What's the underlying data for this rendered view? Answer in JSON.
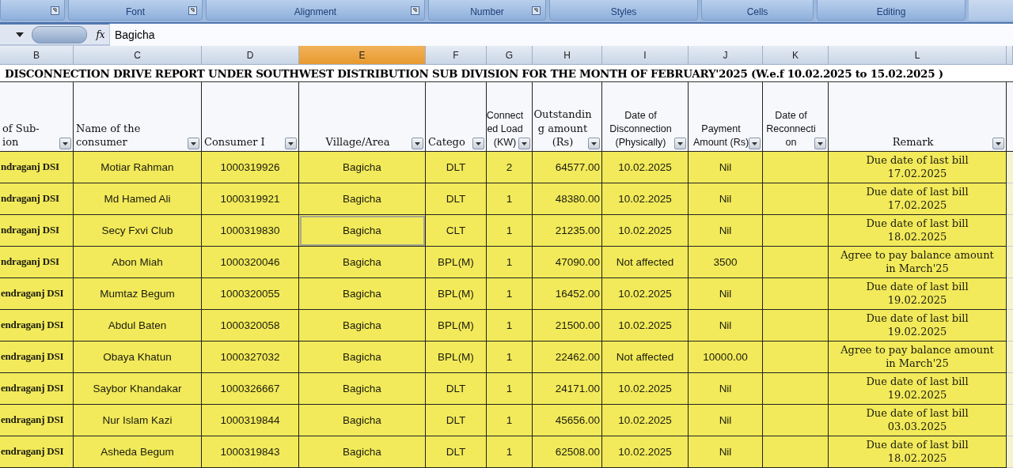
{
  "ribbon": {
    "groups": [
      {
        "launcher": true
      },
      {
        "label": "Font",
        "launcher": true
      },
      {
        "label": "Alignment",
        "launcher": true
      },
      {
        "label": "Number",
        "launcher": true
      },
      {
        "label": "Styles",
        "launcher": false
      },
      {
        "label": "Cells",
        "launcher": false
      },
      {
        "label": "Editing",
        "launcher": false
      }
    ]
  },
  "formula_bar": {
    "function_label": "fx",
    "value": "Bagicha"
  },
  "columns": [
    {
      "letter": "B",
      "selected": false
    },
    {
      "letter": "C",
      "selected": false
    },
    {
      "letter": "D",
      "selected": false
    },
    {
      "letter": "E",
      "selected": true
    },
    {
      "letter": "F",
      "selected": false
    },
    {
      "letter": "G",
      "selected": false
    },
    {
      "letter": "H",
      "selected": false
    },
    {
      "letter": "I",
      "selected": false
    },
    {
      "letter": "J",
      "selected": false
    },
    {
      "letter": "K",
      "selected": false
    },
    {
      "letter": "L",
      "selected": false
    }
  ],
  "title": "DISCONNECTION DRIVE REPORT UNDER SOUTHWEST DISTRIBUTION SUB DIVISION FOR THE MONTH OF FEBRUARY'2025 (W.e.f 10.02.2025 to 15.02.2025 )",
  "headers": [
    "of Sub-\nion",
    "Name of the\nconsumer",
    "Consumer I",
    "Village/Area",
    "Catego",
    "Connect\ned Load\n(KW)",
    "Outstandin\ng  amount\n(Rs)",
    "Date of\nDisconnection\n(Physically)",
    "Payment\nAmount (Rs)",
    "Date of\nReconnecti\non",
    "Remark"
  ],
  "rows": [
    {
      "sub_division": "ndraganj DSI",
      "name": "Motiar Rahman",
      "consumer_id": "1000319926",
      "village": "Bagicha",
      "village_cell_selected": false,
      "category": "DLT",
      "load": "2",
      "outstanding": "64577.00",
      "disconnection": "10.02.2025",
      "payment": "Nil",
      "remark": "Due date of last bill\n17.02.2025"
    },
    {
      "sub_division": "ndraganj DSI",
      "name": "Md Hamed Ali",
      "consumer_id": "1000319921",
      "village": "Bagicha",
      "village_cell_selected": false,
      "category": "DLT",
      "load": "1",
      "outstanding": "48380.00",
      "disconnection": "10.02.2025",
      "payment": "Nil",
      "remark": "Due date of last bill\n17.02.2025"
    },
    {
      "sub_division": "ndraganj DSI",
      "name": "Secy Fxvi Club",
      "consumer_id": "1000319830",
      "village": "Bagicha",
      "village_cell_selected": true,
      "category": "CLT",
      "load": "1",
      "outstanding": "21235.00",
      "disconnection": "10.02.2025",
      "payment": "Nil",
      "remark": "Due date of last bill\n18.02.2025"
    },
    {
      "sub_division": "ndraganj DSI",
      "name": "Abon Miah",
      "consumer_id": "1000320046",
      "village": "Bagicha",
      "village_cell_selected": false,
      "category": "BPL(M)",
      "load": "1",
      "outstanding": "47090.00",
      "disconnection": "Not affected",
      "payment": "3500",
      "remark": "Agree to pay balance amount\nin March'25"
    },
    {
      "sub_division": "endraganj DSI",
      "name": "Mumtaz Begum",
      "consumer_id": "1000320055",
      "village": "Bagicha",
      "village_cell_selected": false,
      "category": "BPL(M)",
      "load": "1",
      "outstanding": "16452.00",
      "disconnection": "10.02.2025",
      "payment": "Nil",
      "remark": "Due date of last bill\n19.02.2025"
    },
    {
      "sub_division": "endraganj DSI",
      "name": "Abdul Baten",
      "consumer_id": "1000320058",
      "village": "Bagicha",
      "village_cell_selected": false,
      "category": "BPL(M)",
      "load": "1",
      "outstanding": "21500.00",
      "disconnection": "10.02.2025",
      "payment": "Nil",
      "remark": "Due date of last bill\n19.02.2025"
    },
    {
      "sub_division": "endraganj DSI",
      "name": "Obaya Khatun",
      "consumer_id": "1000327032",
      "village": "Bagicha",
      "village_cell_selected": false,
      "category": "BPL(M)",
      "load": "1",
      "outstanding": "22462.00",
      "disconnection": "Not affected",
      "payment": "10000.00",
      "remark": "Agree to pay balance amount\nin March'25"
    },
    {
      "sub_division": "endraganj DSI",
      "name": "Saybor Khandakar",
      "consumer_id": "1000326667",
      "village": "Bagicha",
      "village_cell_selected": false,
      "category": "DLT",
      "load": "1",
      "outstanding": "24171.00",
      "disconnection": "10.02.2025",
      "payment": "Nil",
      "remark": "Due date of last bill\n19.02.2025"
    },
    {
      "sub_division": "endraganj DSI",
      "name": "Nur Islam Kazi",
      "consumer_id": "1000319844",
      "village": "Bagicha",
      "village_cell_selected": false,
      "category": "DLT",
      "load": "1",
      "outstanding": "45656.00",
      "disconnection": "10.02.2025",
      "payment": "Nil",
      "remark": "Due date of last bill\n03.03.2025"
    },
    {
      "sub_division": "endraganj DSI",
      "name": "Asheda Begum",
      "consumer_id": "1000319843",
      "village": "Bagicha",
      "village_cell_selected": false,
      "category": "DLT",
      "load": "1",
      "outstanding": "62508.00",
      "disconnection": "10.02.2025",
      "payment": "Nil",
      "remark": "Due date of last bill\n18.02.2025"
    }
  ]
}
